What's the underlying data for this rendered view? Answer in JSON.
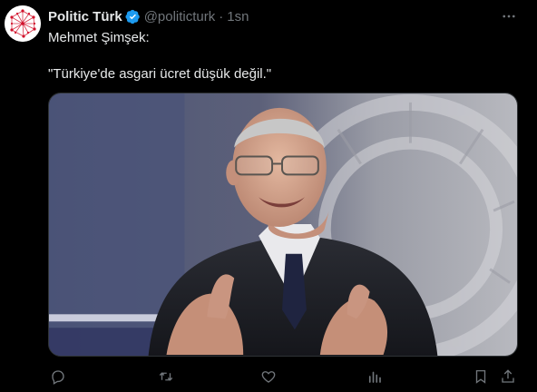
{
  "tweet": {
    "author": {
      "name": "Politic Türk",
      "handle": "@politicturk",
      "separator": "·",
      "time": "1sn"
    },
    "text_line_1": "Mehmet Şimşek:",
    "text_line_2": "\"Türkiye'de asgari ücret düşük değil.\"",
    "media": {
      "icon": "photo-of-speaker"
    },
    "actions": {
      "icons": [
        "reply-icon",
        "retweet-icon",
        "like-icon",
        "views-icon",
        "bookmark-icon",
        "share-icon"
      ]
    },
    "colors": {
      "background": "#000000",
      "text": "#e7e9ea",
      "muted": "#71767b",
      "verified": "#1d9bf0",
      "brand": "#d1112b"
    }
  }
}
